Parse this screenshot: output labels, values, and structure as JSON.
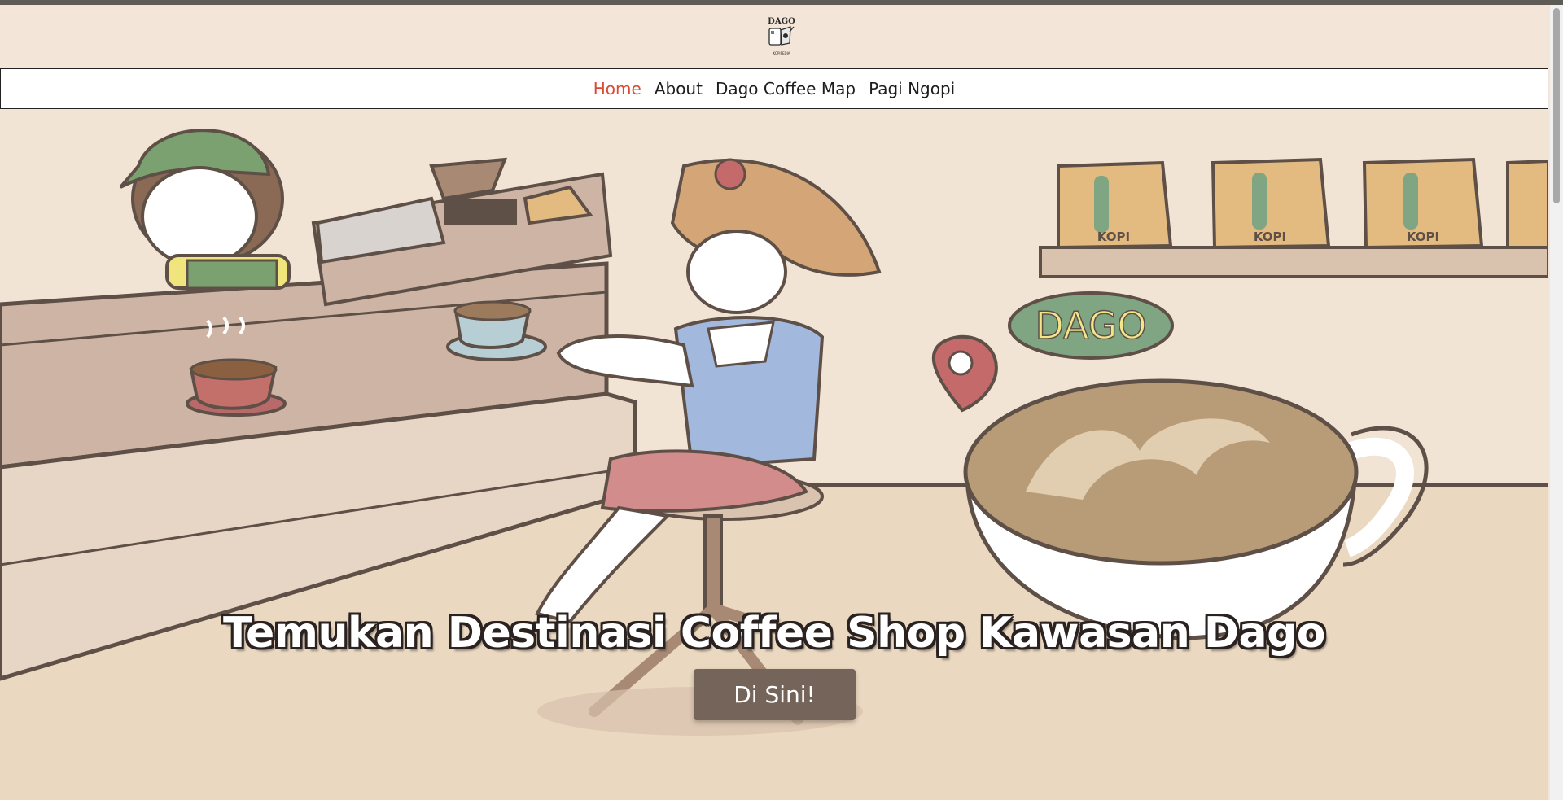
{
  "brand": {
    "logo_title": "DAGO",
    "logo_subtitle": "KOPIPEDIA"
  },
  "nav": {
    "items": [
      {
        "label": "Home",
        "active": true
      },
      {
        "label": "About",
        "active": false
      },
      {
        "label": "Dago Coffee Map",
        "active": false
      },
      {
        "label": "Pagi Ngopi",
        "active": false
      }
    ]
  },
  "hero": {
    "headline": "Temukan Destinasi Coffee Shop Kawasan Dago",
    "cta_label": "Di Sini!",
    "illustration": {
      "bag_label": "KOPI",
      "sign_label": "DAGO"
    }
  },
  "colors": {
    "accent": "#dc4a32",
    "button": "#75645a",
    "background": "#f3e6d8",
    "topline": "#5e5d55"
  }
}
